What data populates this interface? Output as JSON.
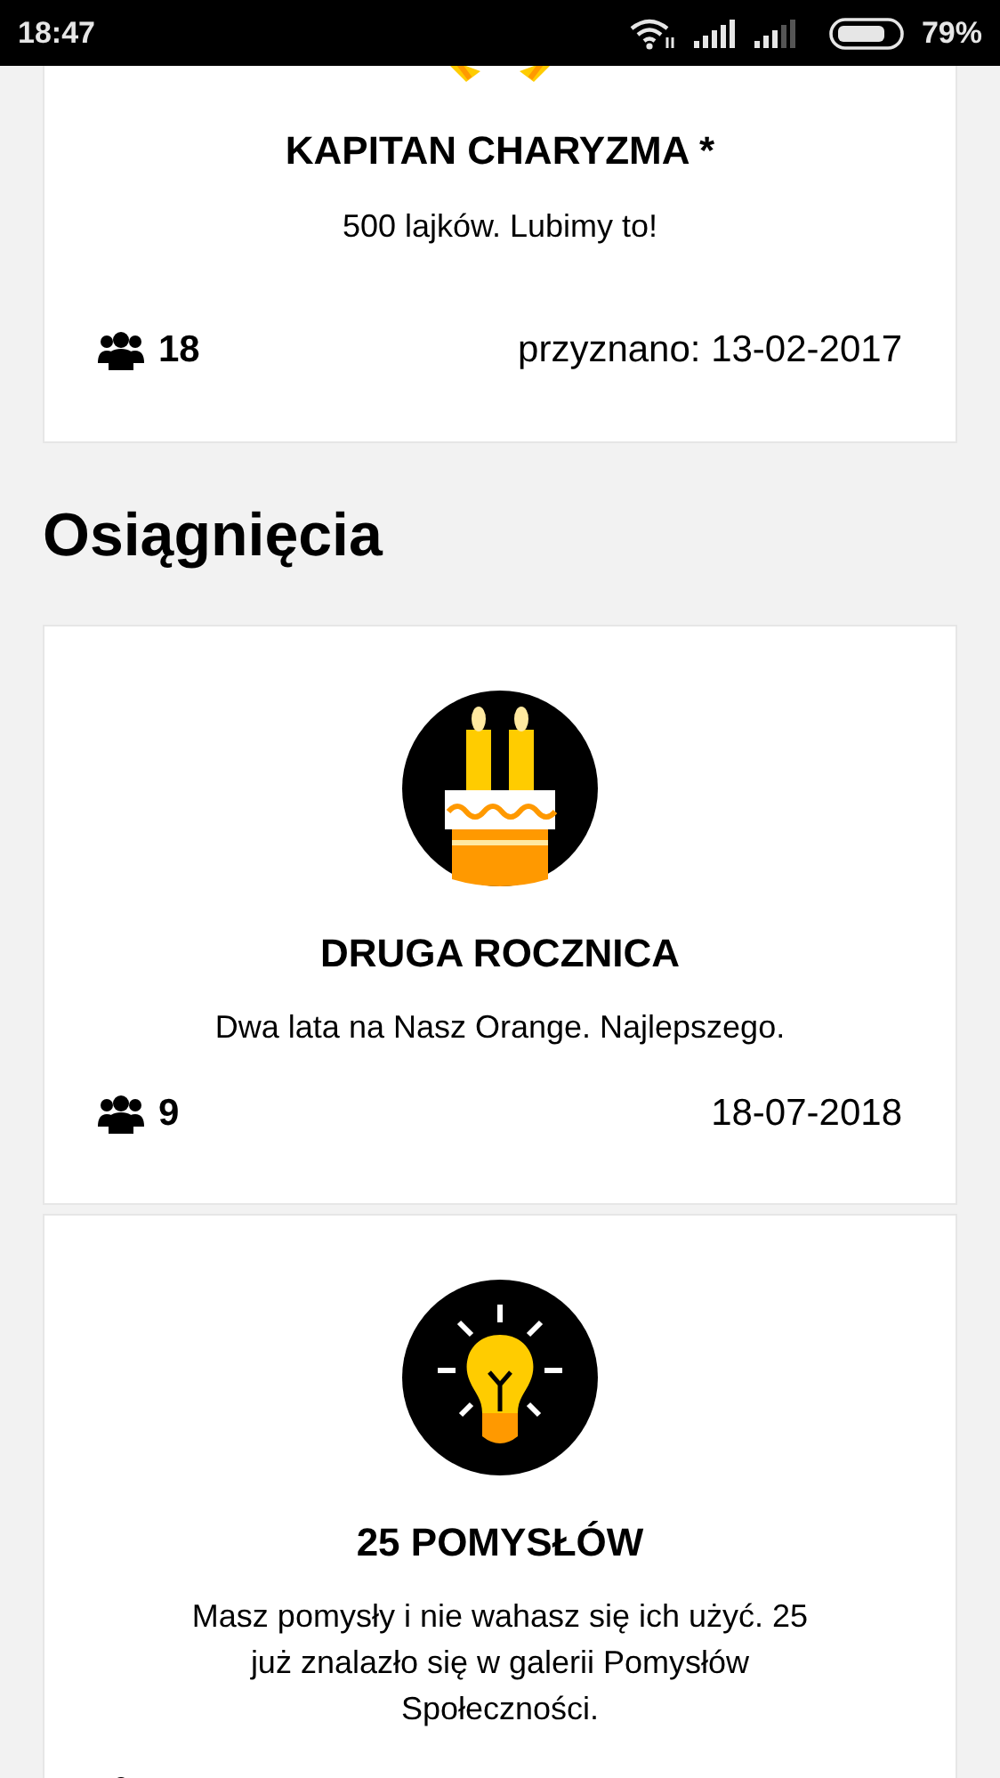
{
  "status_bar": {
    "time": "18:47",
    "battery": "79%"
  },
  "top_card": {
    "title": "KAPITAN CHARYZMA *",
    "description": "500 lajków. Lubimy to!",
    "members": "18",
    "awarded": "przyznano: 13-02-2017"
  },
  "section_title": "Osiągnięcia",
  "achievements": [
    {
      "kind": "cake",
      "title": "DRUGA ROCZNICA",
      "description": "Dwa lata na Nasz Orange. Najlepszego.",
      "members": "9",
      "date": "18-07-2018"
    },
    {
      "kind": "bulb",
      "title": "25 POMYSŁÓW",
      "description": "Masz pomysły i nie wahasz się ich użyć. 25 już znalazło się w galerii Pomysłów Społeczności."
    }
  ]
}
